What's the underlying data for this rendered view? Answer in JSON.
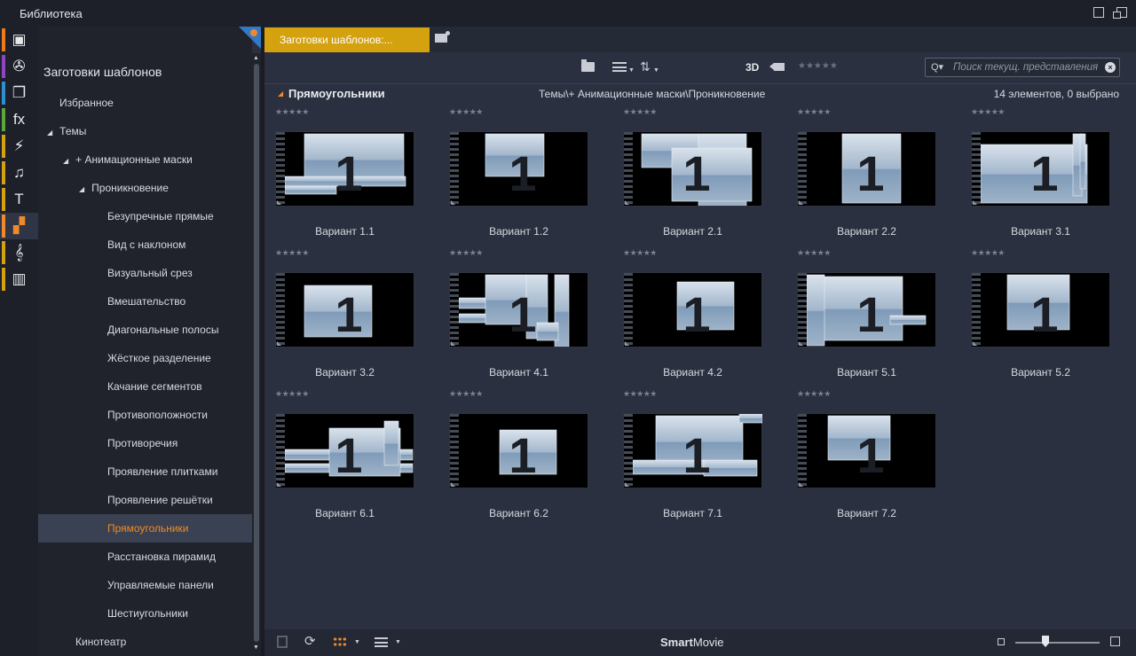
{
  "window": {
    "title": "Библиотека"
  },
  "rail": {
    "items": [
      {
        "icon": "box-icon",
        "glyph": "▣",
        "color": "#ef7a1a"
      },
      {
        "icon": "film-reel-icon",
        "glyph": "✇",
        "color": "#8e44c4"
      },
      {
        "icon": "photos-icon",
        "glyph": "❐",
        "color": "#2d8fd0"
      },
      {
        "icon": "fx-icon",
        "glyph": "fx",
        "color": "#58a83a"
      },
      {
        "icon": "lightning-icon",
        "glyph": "⚡",
        "color": "#d4a10f"
      },
      {
        "icon": "music-note-icon",
        "glyph": "♫",
        "color": "#d4a10f"
      },
      {
        "icon": "title-t-icon",
        "glyph": "T",
        "color": "#d4a10f"
      },
      {
        "icon": "montage-blocks-icon",
        "glyph": "▞",
        "color": "#ef8a2c",
        "active": true
      },
      {
        "icon": "treble-clef-icon",
        "glyph": "𝄞",
        "color": "#d4a10f"
      },
      {
        "icon": "piano-keys-icon",
        "glyph": "▥",
        "color": "#d4a10f"
      }
    ]
  },
  "tree": {
    "header": "Заготовки шаблонов",
    "items": [
      {
        "label": "Избранное",
        "indent": 24,
        "tri": ""
      },
      {
        "label": "Темы",
        "indent": 10,
        "tri": "◢"
      },
      {
        "label": "+ Анимационные маски",
        "indent": 28,
        "tri": "◢"
      },
      {
        "label": "Проникновение",
        "indent": 46,
        "tri": "◢"
      },
      {
        "label": "Безупречные прямые",
        "indent": 78,
        "tri": ""
      },
      {
        "label": "Вид с наклоном",
        "indent": 78,
        "tri": ""
      },
      {
        "label": "Визуальный срез",
        "indent": 78,
        "tri": ""
      },
      {
        "label": "Вмешательство",
        "indent": 78,
        "tri": ""
      },
      {
        "label": "Диагональные полосы",
        "indent": 78,
        "tri": ""
      },
      {
        "label": "Жёсткое разделение",
        "indent": 78,
        "tri": ""
      },
      {
        "label": "Качание сегментов",
        "indent": 78,
        "tri": ""
      },
      {
        "label": "Противоположности",
        "indent": 78,
        "tri": ""
      },
      {
        "label": "Противоречия",
        "indent": 78,
        "tri": ""
      },
      {
        "label": "Проявление плитками",
        "indent": 78,
        "tri": ""
      },
      {
        "label": "Проявление решётки",
        "indent": 78,
        "tri": ""
      },
      {
        "label": "Прямоугольники",
        "indent": 78,
        "tri": "",
        "selected": true
      },
      {
        "label": "Расстановка пирамид",
        "indent": 78,
        "tri": ""
      },
      {
        "label": "Управляемые панели",
        "indent": 78,
        "tri": ""
      },
      {
        "label": "Шестиугольники",
        "indent": 78,
        "tri": ""
      },
      {
        "label": "Кинотеатр",
        "indent": 42,
        "tri": ""
      }
    ]
  },
  "tab": {
    "label": "Заготовки шаблонов:..."
  },
  "toolbar": {
    "three_d": "3D",
    "stars": "★★★★★",
    "search_placeholder": "Поиск текущ. представления"
  },
  "section": {
    "name": "Прямоугольники",
    "path": "Темы\\+ Анимационные маски\\Проникновение",
    "count": "14 элементов, 0 выбрано"
  },
  "items": [
    {
      "label": "Вариант 1.1",
      "stars": "★★★★★"
    },
    {
      "label": "Вариант 1.2",
      "stars": "★★★★★"
    },
    {
      "label": "Вариант 2.1",
      "stars": "★★★★★"
    },
    {
      "label": "Вариант 2.2",
      "stars": "★★★★★"
    },
    {
      "label": "Вариант 3.1",
      "stars": "★★★★★"
    },
    {
      "label": "Вариант 3.2",
      "stars": "★★★★★"
    },
    {
      "label": "Вариант 4.1",
      "stars": "★★★★★"
    },
    {
      "label": "Вариант 4.2",
      "stars": "★★★★★"
    },
    {
      "label": "Вариант 5.1",
      "stars": "★★★★★"
    },
    {
      "label": "Вариант 5.2",
      "stars": "★★★★★"
    },
    {
      "label": "Вариант 6.1",
      "stars": "★★★★★"
    },
    {
      "label": "Вариант 6.2",
      "stars": "★★★★★"
    },
    {
      "label": "Вариант 7.1",
      "stars": "★★★★★"
    },
    {
      "label": "Вариант 7.2",
      "stars": "★★★★★"
    }
  ],
  "thumb_numeral": "1",
  "bottom": {
    "brand_bold": "Smart",
    "brand_rest": "Movie"
  },
  "colors": {
    "accent": "#ef8a2c",
    "tab": "#d4a10f",
    "selected_bg": "#3a4152"
  }
}
